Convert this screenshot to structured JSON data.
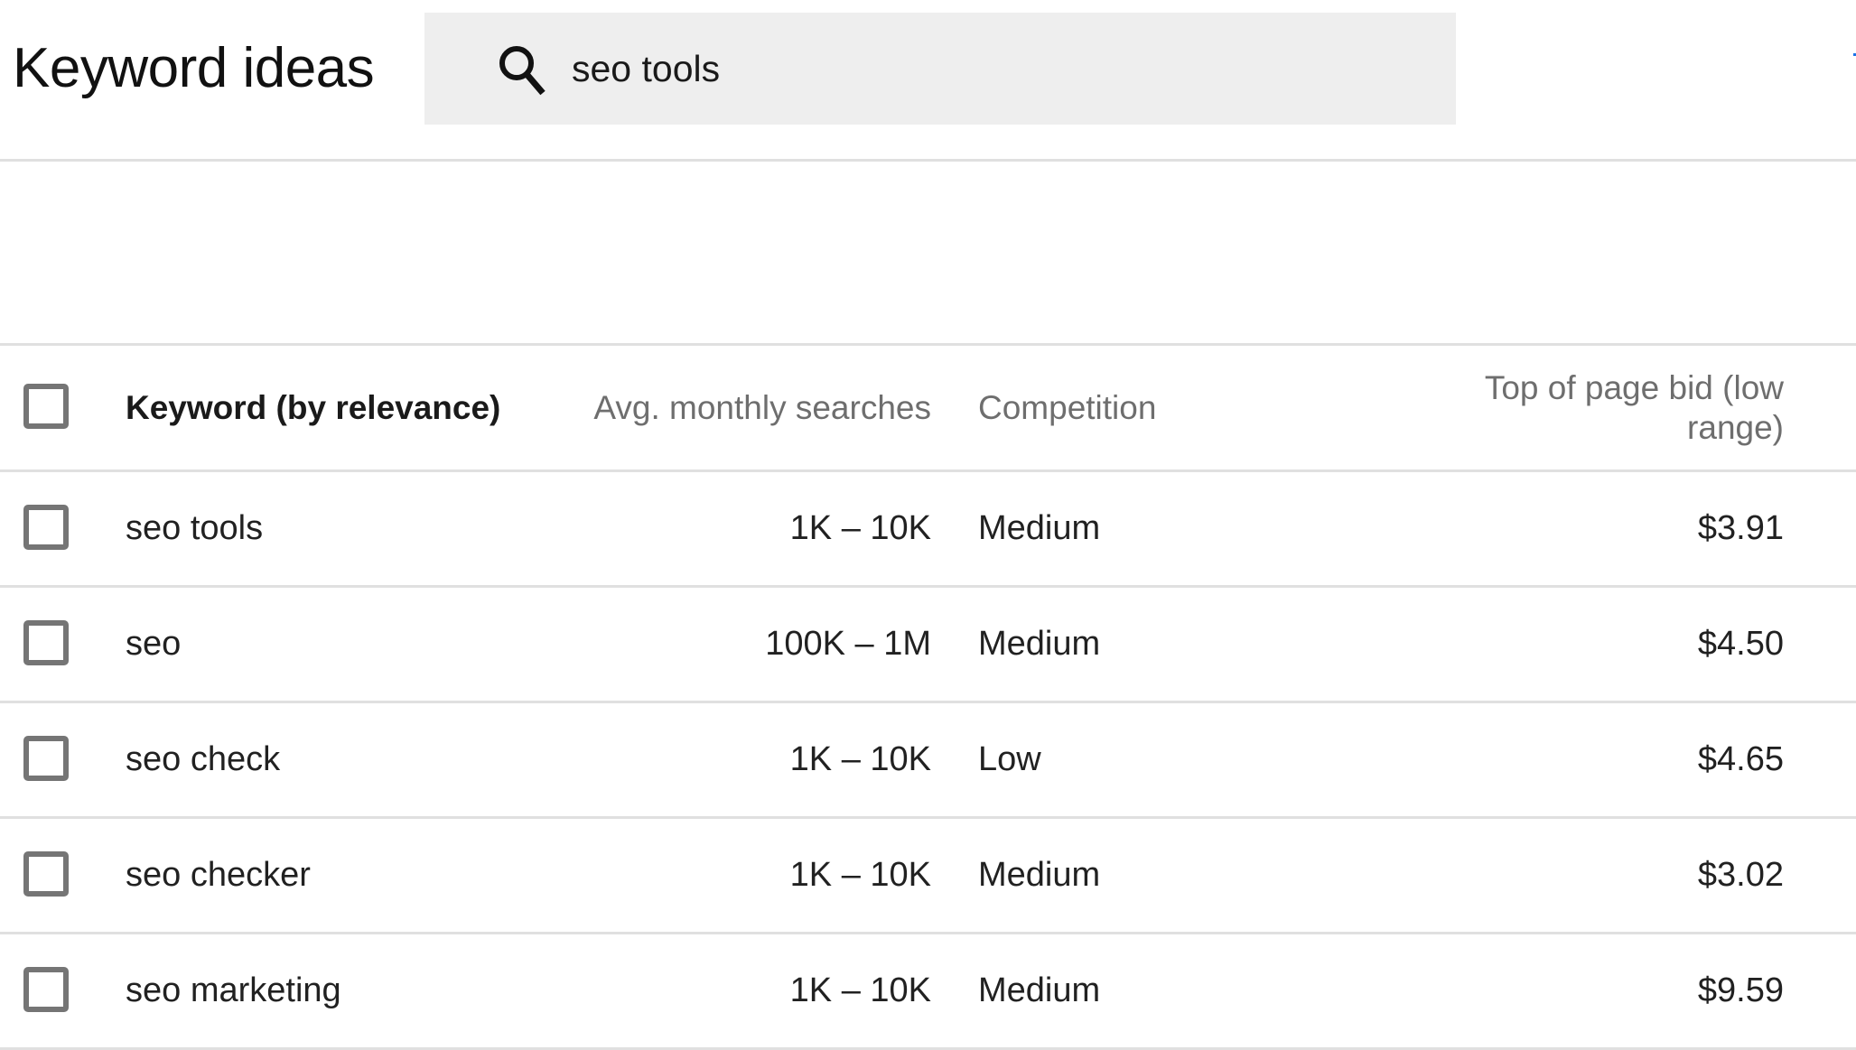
{
  "header": {
    "title": "Keyword ideas"
  },
  "search": {
    "icon": "search-icon",
    "value": "seo tools",
    "placeholder": ""
  },
  "colors": {
    "search_background": "#eeeeee",
    "divider": "#e0e0e0",
    "checkbox_border": "#757575",
    "header_text": "#6e6e6e",
    "body_text": "#212121",
    "edge_accent": "#1a73e8"
  },
  "table": {
    "columns": [
      {
        "key": "keyword",
        "label": "Keyword (by relevance)"
      },
      {
        "key": "searches",
        "label": "Avg. monthly searches"
      },
      {
        "key": "competition",
        "label": "Competition"
      },
      {
        "key": "bid_low",
        "label": "Top of page bid (low range)"
      }
    ],
    "select_all_checked": false,
    "rows": [
      {
        "checked": false,
        "keyword": "seo tools",
        "searches": "1K – 10K",
        "competition": "Medium",
        "bid_low": "$3.91"
      },
      {
        "checked": false,
        "keyword": "seo",
        "searches": "100K – 1M",
        "competition": "Medium",
        "bid_low": "$4.50"
      },
      {
        "checked": false,
        "keyword": "seo check",
        "searches": "1K – 10K",
        "competition": "Low",
        "bid_low": "$4.65"
      },
      {
        "checked": false,
        "keyword": "seo checker",
        "searches": "1K – 10K",
        "competition": "Medium",
        "bid_low": "$3.02"
      },
      {
        "checked": false,
        "keyword": "seo marketing",
        "searches": "1K – 10K",
        "competition": "Medium",
        "bid_low": "$9.59"
      }
    ]
  }
}
